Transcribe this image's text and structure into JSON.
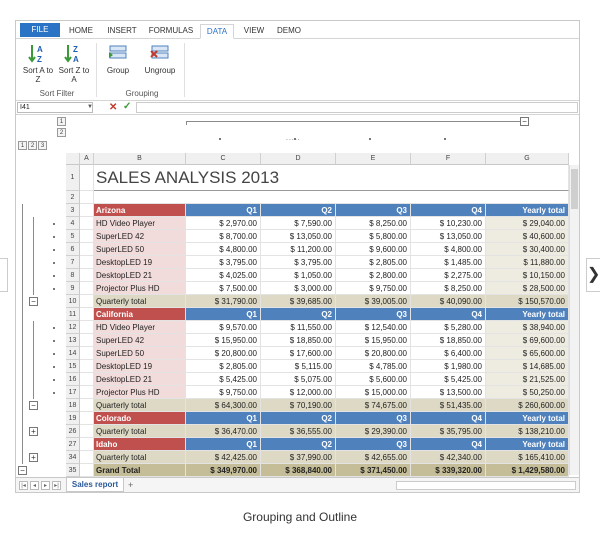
{
  "ribbon": {
    "tabs": [
      "FILE",
      "HOME",
      "INSERT",
      "FORMULAS",
      "DATA",
      "VIEW",
      "DEMO"
    ],
    "active_tab": "DATA",
    "buttons": {
      "sort_az": "Sort A to Z",
      "sort_za": "Sort Z to A",
      "group": "Group",
      "ungroup": "Ungroup"
    },
    "group_labels": {
      "sort_filter": "Sort Filter",
      "grouping": "Grouping"
    }
  },
  "formula_bar": {
    "name_box": "I41",
    "cancel_icon": "x-icon",
    "confirm_icon": "check-icon"
  },
  "outline": {
    "column_levels": [
      "1",
      "2"
    ],
    "row_levels": [
      "1",
      "2",
      "3"
    ],
    "col_collapse": "−",
    "dots": "....."
  },
  "columns": [
    "A",
    "B",
    "C",
    "D",
    "E",
    "F",
    "G"
  ],
  "title": "SALES ANALYSIS 2013",
  "rows": [
    {
      "n": "1",
      "type": "title"
    },
    {
      "n": "2",
      "type": "blank"
    },
    {
      "n": "3",
      "type": "region",
      "cells": [
        "Arizona",
        "Q1",
        "Q2",
        "Q3",
        "Q4",
        "Yearly total"
      ]
    },
    {
      "n": "4",
      "type": "data",
      "cells": [
        "HD Video Player",
        "$ 2,970.00",
        "$ 7,590.00",
        "$ 8,250.00",
        "$ 10,230.00",
        "$ 29,040.00"
      ]
    },
    {
      "n": "5",
      "type": "data",
      "cells": [
        "SuperLED 42",
        "$ 8,700.00",
        "$ 13,050.00",
        "$ 5,800.00",
        "$ 13,050.00",
        "$ 40,600.00"
      ]
    },
    {
      "n": "6",
      "type": "data",
      "cells": [
        "SuperLED 50",
        "$ 4,800.00",
        "$ 11,200.00",
        "$ 9,600.00",
        "$ 4,800.00",
        "$ 30,400.00"
      ]
    },
    {
      "n": "7",
      "type": "data",
      "cells": [
        "DesktopLED 19",
        "$ 3,795.00",
        "$ 3,795.00",
        "$ 2,805.00",
        "$ 1,485.00",
        "$ 11,880.00"
      ]
    },
    {
      "n": "8",
      "type": "data",
      "cells": [
        "DesktopLED 21",
        "$ 4,025.00",
        "$ 1,050.00",
        "$ 2,800.00",
        "$ 2,275.00",
        "$ 10,150.00"
      ]
    },
    {
      "n": "9",
      "type": "data",
      "cells": [
        "Projector Plus HD",
        "$ 7,500.00",
        "$ 3,000.00",
        "$ 9,750.00",
        "$ 8,250.00",
        "$ 28,500.00"
      ]
    },
    {
      "n": "10",
      "type": "total",
      "cells": [
        "Quarterly total",
        "$ 31,790.00",
        "$ 39,685.00",
        "$ 39,005.00",
        "$ 40,090.00",
        "$ 150,570.00"
      ]
    },
    {
      "n": "11",
      "type": "region",
      "cells": [
        "California",
        "Q1",
        "Q2",
        "Q3",
        "Q4",
        "Yearly total"
      ]
    },
    {
      "n": "12",
      "type": "data",
      "cells": [
        "HD Video Player",
        "$ 9,570.00",
        "$ 11,550.00",
        "$ 12,540.00",
        "$ 5,280.00",
        "$ 38,940.00"
      ]
    },
    {
      "n": "13",
      "type": "data",
      "cells": [
        "SuperLED 42",
        "$ 15,950.00",
        "$ 18,850.00",
        "$ 15,950.00",
        "$ 18,850.00",
        "$ 69,600.00"
      ]
    },
    {
      "n": "14",
      "type": "data",
      "cells": [
        "SuperLED 50",
        "$ 20,800.00",
        "$ 17,600.00",
        "$ 20,800.00",
        "$ 6,400.00",
        "$ 65,600.00"
      ]
    },
    {
      "n": "15",
      "type": "data",
      "cells": [
        "DesktopLED 19",
        "$ 2,805.00",
        "$ 5,115.00",
        "$ 4,785.00",
        "$ 1,980.00",
        "$ 14,685.00"
      ]
    },
    {
      "n": "16",
      "type": "data",
      "cells": [
        "DesktopLED 21",
        "$ 5,425.00",
        "$ 5,075.00",
        "$ 5,600.00",
        "$ 5,425.00",
        "$ 21,525.00"
      ]
    },
    {
      "n": "17",
      "type": "data",
      "cells": [
        "Projector Plus HD",
        "$ 9,750.00",
        "$ 12,000.00",
        "$ 15,000.00",
        "$ 13,500.00",
        "$ 50,250.00"
      ]
    },
    {
      "n": "18",
      "type": "total",
      "cells": [
        "Quarterly total",
        "$ 64,300.00",
        "$ 70,190.00",
        "$ 74,675.00",
        "$ 51,435.00",
        "$ 260,600.00"
      ]
    },
    {
      "n": "19",
      "type": "region",
      "cells": [
        "Colorado",
        "Q1",
        "Q2",
        "Q3",
        "Q4",
        "Yearly total"
      ]
    },
    {
      "n": "26",
      "type": "total",
      "cells": [
        "Quarterly total",
        "$ 36,470.00",
        "$ 36,555.00",
        "$ 29,390.00",
        "$ 35,795.00",
        "$ 138,210.00"
      ]
    },
    {
      "n": "27",
      "type": "region",
      "cells": [
        "Idaho",
        "Q1",
        "Q2",
        "Q3",
        "Q4",
        "Yearly total"
      ]
    },
    {
      "n": "34",
      "type": "total",
      "cells": [
        "Quarterly total",
        "$ 42,425.00",
        "$ 37,990.00",
        "$ 42,655.00",
        "$ 42,340.00",
        "$ 165,410.00"
      ]
    },
    {
      "n": "35",
      "type": "grand",
      "cells": [
        "Grand Total",
        "$ 349,970.00",
        "$ 368,840.00",
        "$ 371,450.00",
        "$ 339,320.00",
        "$ 1,429,580.00"
      ]
    }
  ],
  "sheet_tabs": {
    "active": "Sales report",
    "add": "+"
  },
  "nav_right": "❯",
  "caption": "Grouping and Outline",
  "colors": {
    "region_label": "#c0504d",
    "region_bar": "#4f81bd",
    "label_light": "#f2dcdb",
    "total_row": "#ddd9c4",
    "yearly_light": "#eeece1",
    "grand_row": "#c4bd97"
  }
}
